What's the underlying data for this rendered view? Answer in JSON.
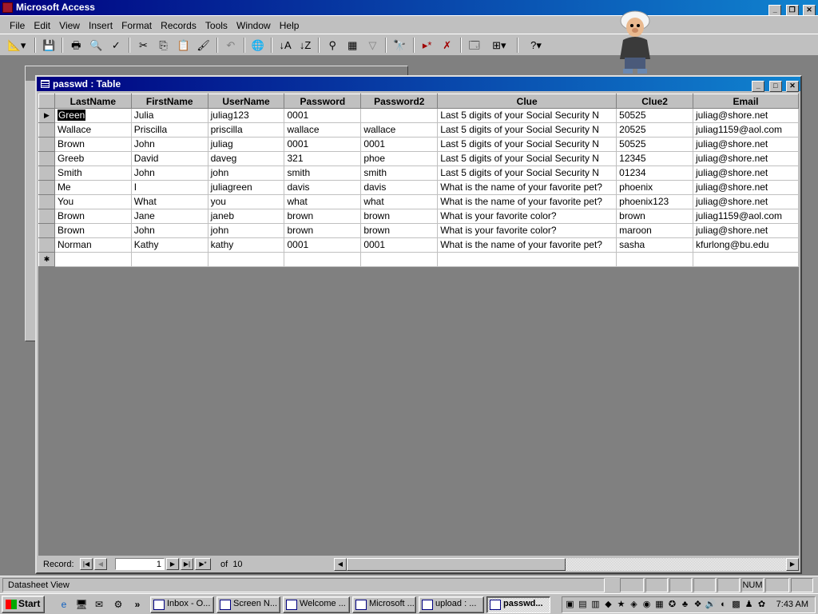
{
  "app": {
    "title": "Microsoft Access"
  },
  "menu": [
    "File",
    "Edit",
    "View",
    "Insert",
    "Format",
    "Records",
    "Tools",
    "Window",
    "Help"
  ],
  "toolbar": [
    "view-icon",
    "save-icon",
    "print-icon",
    "print-preview-icon",
    "spelling-icon",
    "cut-icon",
    "copy-icon",
    "paste-icon",
    "format-painter-icon",
    "undo-icon",
    "hyperlink-icon",
    "sort-ascending-icon",
    "sort-descending-icon",
    "filter-by-selection-icon",
    "filter-by-form-icon",
    "apply-filter-icon",
    "find-icon",
    "new-record-icon",
    "delete-record-icon",
    "database-window-icon",
    "new-object-icon",
    "help-icon"
  ],
  "table_window": {
    "title": "passwd : Table"
  },
  "table": {
    "columns": [
      "LastName",
      "FirstName",
      "UserName",
      "Password",
      "Password2",
      "Clue",
      "Clue2",
      "Email"
    ],
    "rows": [
      [
        "Green",
        "Julia",
        "juliag123",
        "0001",
        "",
        "Last 5 digits of your Social Security N",
        "50525",
        "juliag@shore.net"
      ],
      [
        "Wallace",
        "Priscilla",
        "priscilla",
        "wallace",
        "wallace",
        "Last 5 digits of your Social Security N",
        "20525",
        "juliag1159@aol.com"
      ],
      [
        "Brown",
        "John",
        "juliag",
        "0001",
        "0001",
        "Last 5 digits of your Social Security N",
        "50525",
        "juliag@shore.net"
      ],
      [
        "Greeb",
        "David",
        "daveg",
        "321",
        "phoe",
        "Last 5 digits of your Social Security N",
        "12345",
        "juliag@shore.net"
      ],
      [
        "Smith",
        "John",
        "john",
        "smith",
        "smith",
        "Last 5 digits of your Social Security N",
        "01234",
        "juliag@shore.net"
      ],
      [
        "Me",
        "I",
        "juliagreen",
        "davis",
        "davis",
        "What is the name of your favorite pet?",
        "phoenix",
        "juliag@shore.net"
      ],
      [
        "You",
        "What",
        "you",
        "what",
        "what",
        "What is the name of your favorite pet?",
        "phoenix123",
        "juliag@shore.net"
      ],
      [
        "Brown",
        "Jane",
        "janeb",
        "brown",
        "brown",
        "What is your favorite color?",
        "brown",
        "juliag1159@aol.com"
      ],
      [
        "Brown",
        "John",
        "john",
        "brown",
        "brown",
        "What is your favorite color?",
        "maroon",
        "juliag@shore.net"
      ],
      [
        "Norman",
        "Kathy",
        "kathy",
        "0001",
        "0001",
        "What is the name of your favorite pet?",
        "sasha",
        "kfurlong@bu.edu"
      ]
    ]
  },
  "navigation": {
    "label": "Record:",
    "current": "1",
    "of_label": "of",
    "total": "10"
  },
  "status": {
    "text": "Datasheet View",
    "num": "NUM"
  },
  "taskbar": {
    "start": "Start",
    "tasks": [
      "Inbox - O...",
      "Screen N...",
      "Welcome ...",
      "Microsoft ...",
      "upload : ...",
      "passwd..."
    ],
    "clock": "7:43 AM"
  }
}
